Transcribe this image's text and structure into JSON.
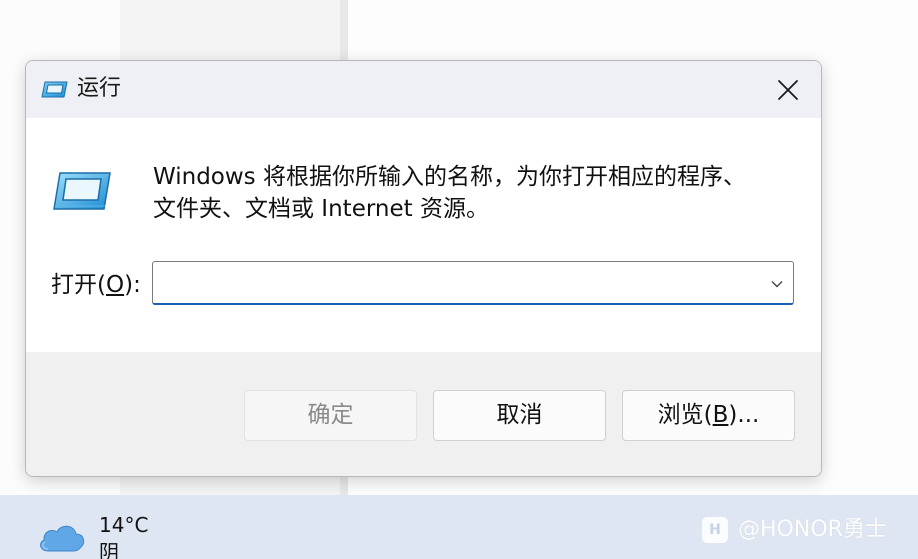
{
  "dialog": {
    "title": "运行",
    "description_line1": "Windows 将根据你所输入的名称，为你打开相应的程序、",
    "description_line2": "文件夹、文档或 Internet 资源。",
    "open_label_prefix": "打开(",
    "open_label_accel": "O",
    "open_label_suffix": "):",
    "open_value": "",
    "buttons": {
      "ok": "确定",
      "cancel": "取消",
      "browse_prefix": "浏览(",
      "browse_accel": "B",
      "browse_suffix": ")..."
    },
    "icons": {
      "title": "run-icon",
      "body": "run-icon",
      "close": "close-icon",
      "dropdown": "chevron-down-icon"
    }
  },
  "taskbar": {
    "temperature": "14°C",
    "condition": "阴",
    "weather_icon": "cloud-icon"
  },
  "watermark": {
    "text": "@HONOR勇士"
  },
  "colors": {
    "accent": "#1a5fb4",
    "titlebar": "#eef0f5",
    "footer": "#f0f0f0",
    "taskbar": "#dfe6f3"
  }
}
